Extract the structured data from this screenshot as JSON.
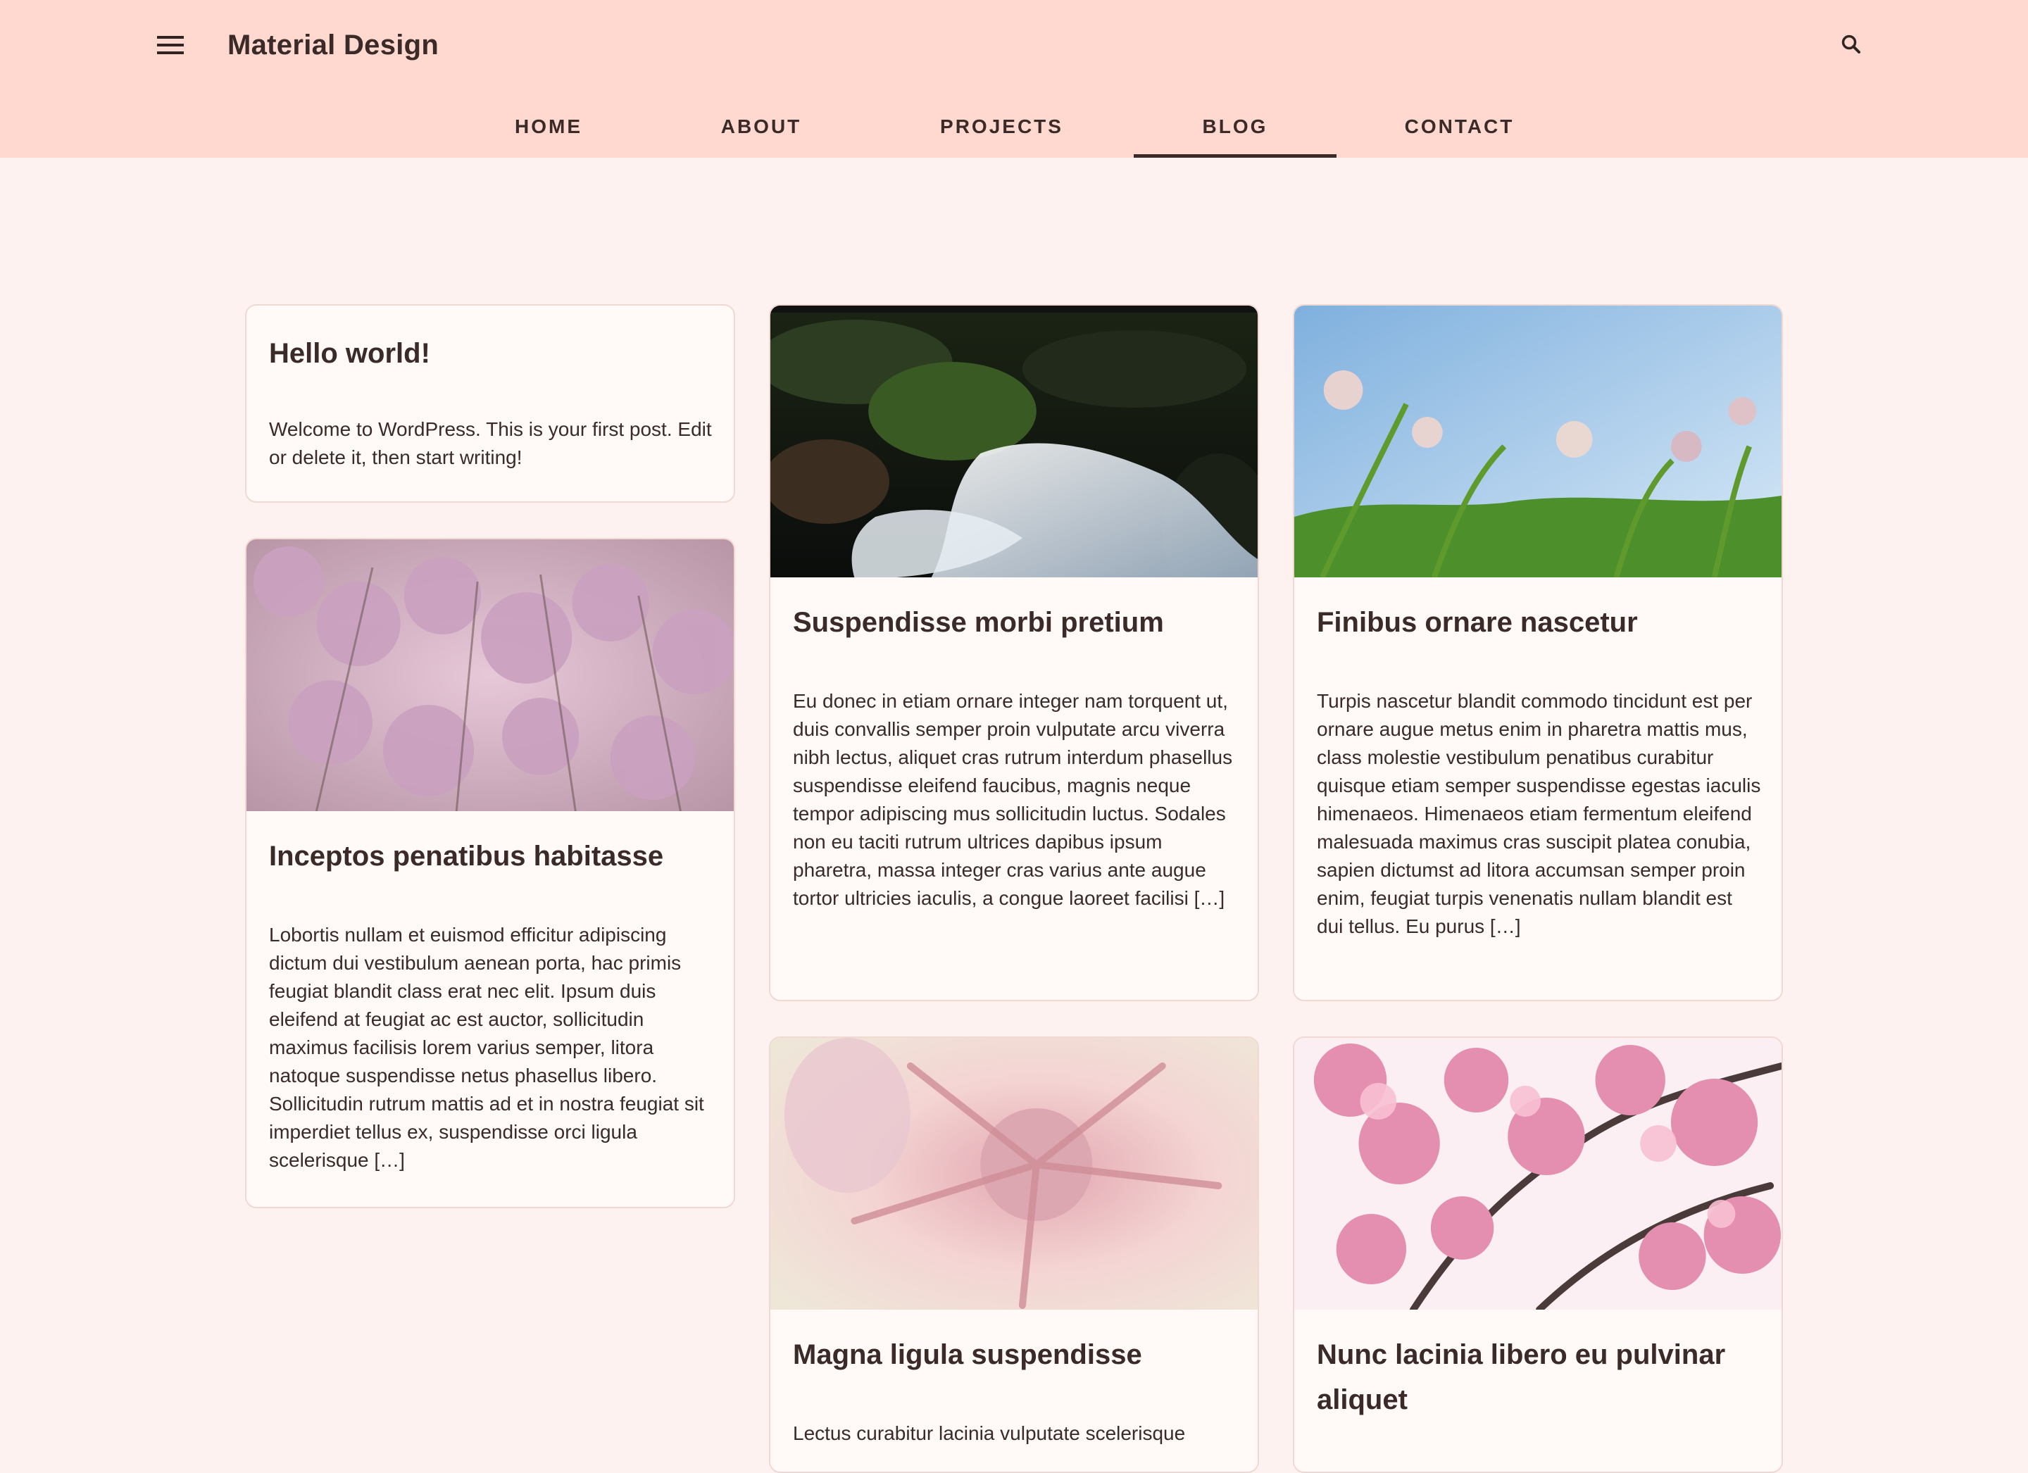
{
  "header": {
    "site_title": "Material Design",
    "menu_icon": "hamburger-menu-icon",
    "search_icon": "search-icon",
    "background": "#ffd9d0"
  },
  "nav": {
    "tabs": [
      {
        "label": "HOME",
        "active": false
      },
      {
        "label": "ABOUT",
        "active": false
      },
      {
        "label": "PROJECTS",
        "active": false
      },
      {
        "label": "BLOG",
        "active": true
      },
      {
        "label": "CONTACT",
        "active": false
      }
    ]
  },
  "posts": [
    {
      "title": "Hello world!",
      "excerpt": "Welcome to WordPress. This is your first post. Edit or delete it, then start writing!",
      "image": null
    },
    {
      "title": "Suspendisse morbi pretium",
      "excerpt": "Eu donec in etiam ornare integer nam torquent ut, duis convallis semper proin vulputate arcu viverra nibh lectus, aliquet cras rutrum interdum phasellus suspendisse eleifend faucibus, magnis neque tempor adipiscing mus sollicitudin luctus. Sodales non eu taciti rutrum ultrices dapibus ipsum pharetra, massa integer cras varius ante augue tortor ultricies iaculis, a congue laoreet facilisi […]",
      "image": "waterfall-stream"
    },
    {
      "title": "Finibus ornare nascetur",
      "excerpt": "Turpis nascetur blandit commodo tincidunt est per ornare augue metus enim in pharetra mattis mus, class molestie vestibulum penatibus curabitur quisque etiam semper suspendisse egestas iaculis himenaeos. Himenaeos etiam fermentum eleifend malesuada maximus cras suscipit platea conubia, sapien dictumst ad litora accumsan semper proin enim, feugiat turpis venenatis nullam blandit est dui tellus. Eu purus […]",
      "image": "wildflowers-blue-sky"
    },
    {
      "title": "Inceptos penatibus habitasse",
      "excerpt": "Lobortis nullam et euismod efficitur adipiscing dictum dui vestibulum aenean porta, hac primis feugiat blandit class erat nec elit. Ipsum duis eleifend at feugiat ac est auctor, sollicitudin maximus facilisis lorem varius semper, litora natoque suspendisse netus phasellus libero. Sollicitudin rutrum mattis ad et in nostra feugiat sit imperdiet tellus ex, suspendisse orci ligula scelerisque […]",
      "image": "pink-limonium-flowers"
    },
    {
      "title": "Magna ligula suspendisse",
      "excerpt": "Lectus curabitur lacinia vulputate scelerisque",
      "image": "pink-protea-closeup"
    },
    {
      "title": "Nunc lacinia libero eu pulvinar aliquet",
      "excerpt": "",
      "image": "cherry-blossom-branch"
    }
  ]
}
